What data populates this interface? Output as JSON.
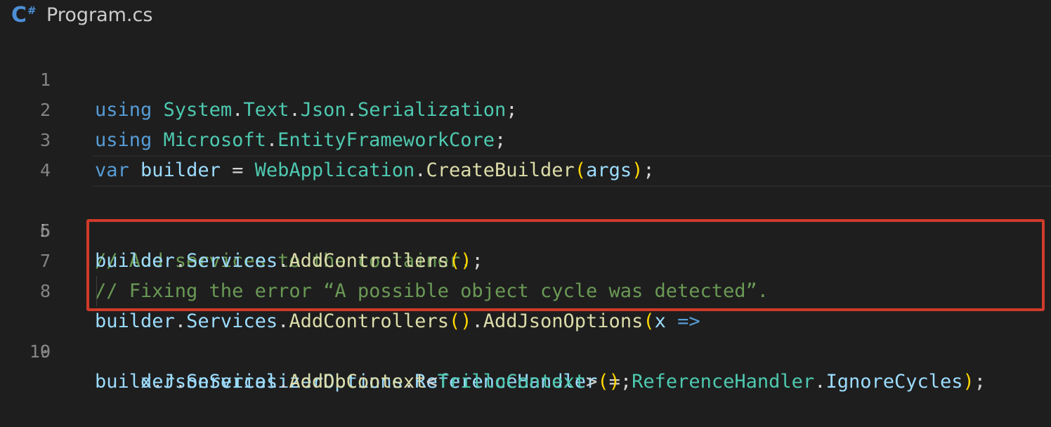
{
  "tab": {
    "icon": "csharp-file-icon",
    "icon_c": "C",
    "icon_sharp": "#",
    "filename": "Program.cs"
  },
  "editor": {
    "active_line": 5,
    "lines": [
      {
        "num": "1",
        "tokens": [
          "using",
          "System",
          ".",
          "Text",
          ".",
          "Json",
          ".",
          "Serialization",
          ";"
        ]
      },
      {
        "num": "2",
        "tokens": [
          "using",
          "Microsoft",
          ".",
          "EntityFrameworkCore",
          ";"
        ]
      },
      {
        "num": "3",
        "tokens": [
          "var",
          "builder",
          "=",
          "WebApplication",
          ".",
          "CreateBuilder",
          "(",
          "args",
          ")",
          ";"
        ]
      },
      {
        "num": "4",
        "tokens": []
      },
      {
        "num": "5",
        "tokens": [
          "// Add services to the container."
        ]
      },
      {
        "num": "6",
        "tokens": [
          "builder",
          ".",
          "Services",
          ".",
          "AddControllers",
          "(",
          ")",
          ";"
        ]
      },
      {
        "num": "7",
        "tokens": [
          "// Fixing the error “A possible object cycle was detected”."
        ]
      },
      {
        "num": "8",
        "tokens": [
          "builder",
          ".",
          "Services",
          ".",
          "AddControllers",
          "(",
          ")",
          ".",
          "AddJsonOptions",
          "(",
          "x",
          "=>"
        ]
      },
      {
        "num": "9",
        "tokens": [
          "x",
          ".",
          "JsonSerializerOptions",
          ".",
          "ReferenceHandler",
          "=",
          "ReferenceHandler",
          ".",
          "IgnoreCycles",
          ")",
          ";"
        ]
      },
      {
        "num": "10",
        "tokens": [
          "builder",
          ".",
          "Services",
          ".",
          "AddDbContext",
          "<",
          "TrilloContext",
          ">",
          "(",
          ")",
          ";"
        ]
      }
    ]
  },
  "colors": {
    "background": "#1e1e1e",
    "keyword": "#569cd6",
    "type": "#4ec9b0",
    "function": "#dcdcaa",
    "variable": "#9cdcfe",
    "comment": "#6a9955",
    "bracket": "#ffd700",
    "bracket_nested": "#da70d6",
    "highlight_box": "#d03a2a"
  }
}
